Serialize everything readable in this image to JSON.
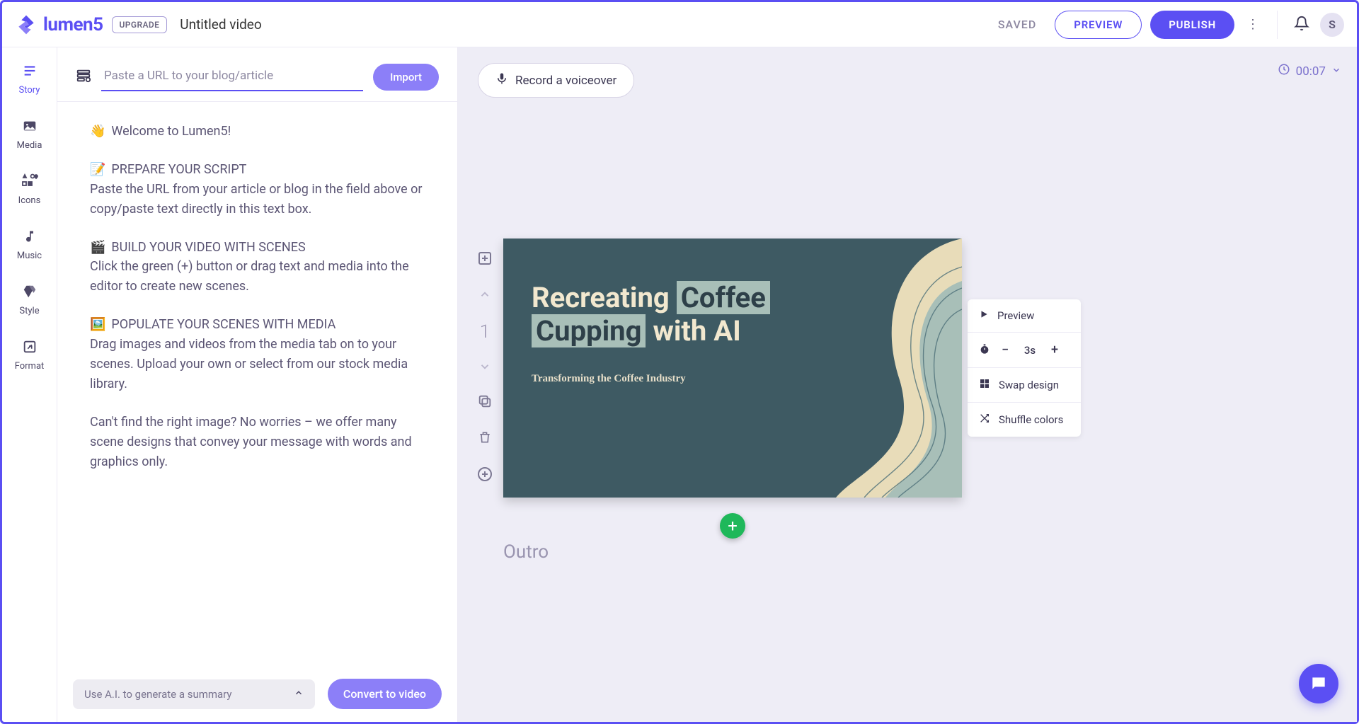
{
  "brand": {
    "name": "lumen5"
  },
  "topbar": {
    "upgrade": "UPGRADE",
    "video_title": "Untitled video",
    "saved": "SAVED",
    "preview": "PREVIEW",
    "publish": "PUBLISH",
    "avatar_initial": "S"
  },
  "rail": {
    "story": "Story",
    "media": "Media",
    "icons": "Icons",
    "music": "Music",
    "style": "Style",
    "format": "Format"
  },
  "story": {
    "url_placeholder": "Paste a URL to your blog/article",
    "import": "Import",
    "welcome": "Welcome to Lumen5!",
    "h1": "PREPARE YOUR SCRIPT",
    "p1": "Paste the URL from your article or blog in the field above or copy/paste text directly in this text box.",
    "h2": "BUILD YOUR VIDEO WITH SCENES",
    "p2": "Click the green (+) button or drag text and media into the editor to create new scenes.",
    "h3": "POPULATE YOUR SCENES WITH MEDIA",
    "p3": "Drag images and videos from the media tab on to your scenes. Upload your own or select from our stock media library.",
    "p4": "Can't find the right image? No worries – we offer many scene designs that convey your message with words and graphics only.",
    "ai_summary": "Use A.I. to generate a summary",
    "convert": "Convert to video"
  },
  "canvas": {
    "record": "Record a voiceover",
    "duration": "00:07",
    "scene_number": "1",
    "outro": "Outro",
    "actions": {
      "preview": "Preview",
      "duration_value": "3s",
      "swap": "Swap design",
      "shuffle": "Shuffle colors"
    },
    "scene": {
      "t1": "Recreating",
      "t2": "Coffee",
      "t3": "Cupping",
      "t4": "with AI",
      "subtitle": "Transforming the Coffee Industry"
    }
  }
}
